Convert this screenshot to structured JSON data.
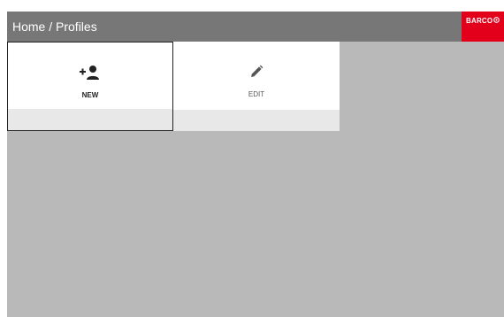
{
  "header": {
    "breadcrumb": "Home / Profiles",
    "logo_text": "BARCO",
    "logo_color": "#e2001a"
  },
  "tiles": [
    {
      "label": "NEW",
      "icon": "add-person-icon",
      "selected": true
    },
    {
      "label": "EDIT",
      "icon": "pencil-icon",
      "selected": false
    }
  ],
  "colors": {
    "header_bg": "#777777",
    "content_bg": "#b9b9b9",
    "tile_bg": "#ffffff",
    "tile_footer_bg": "#e8e8e8",
    "selected_border": "#222222"
  }
}
